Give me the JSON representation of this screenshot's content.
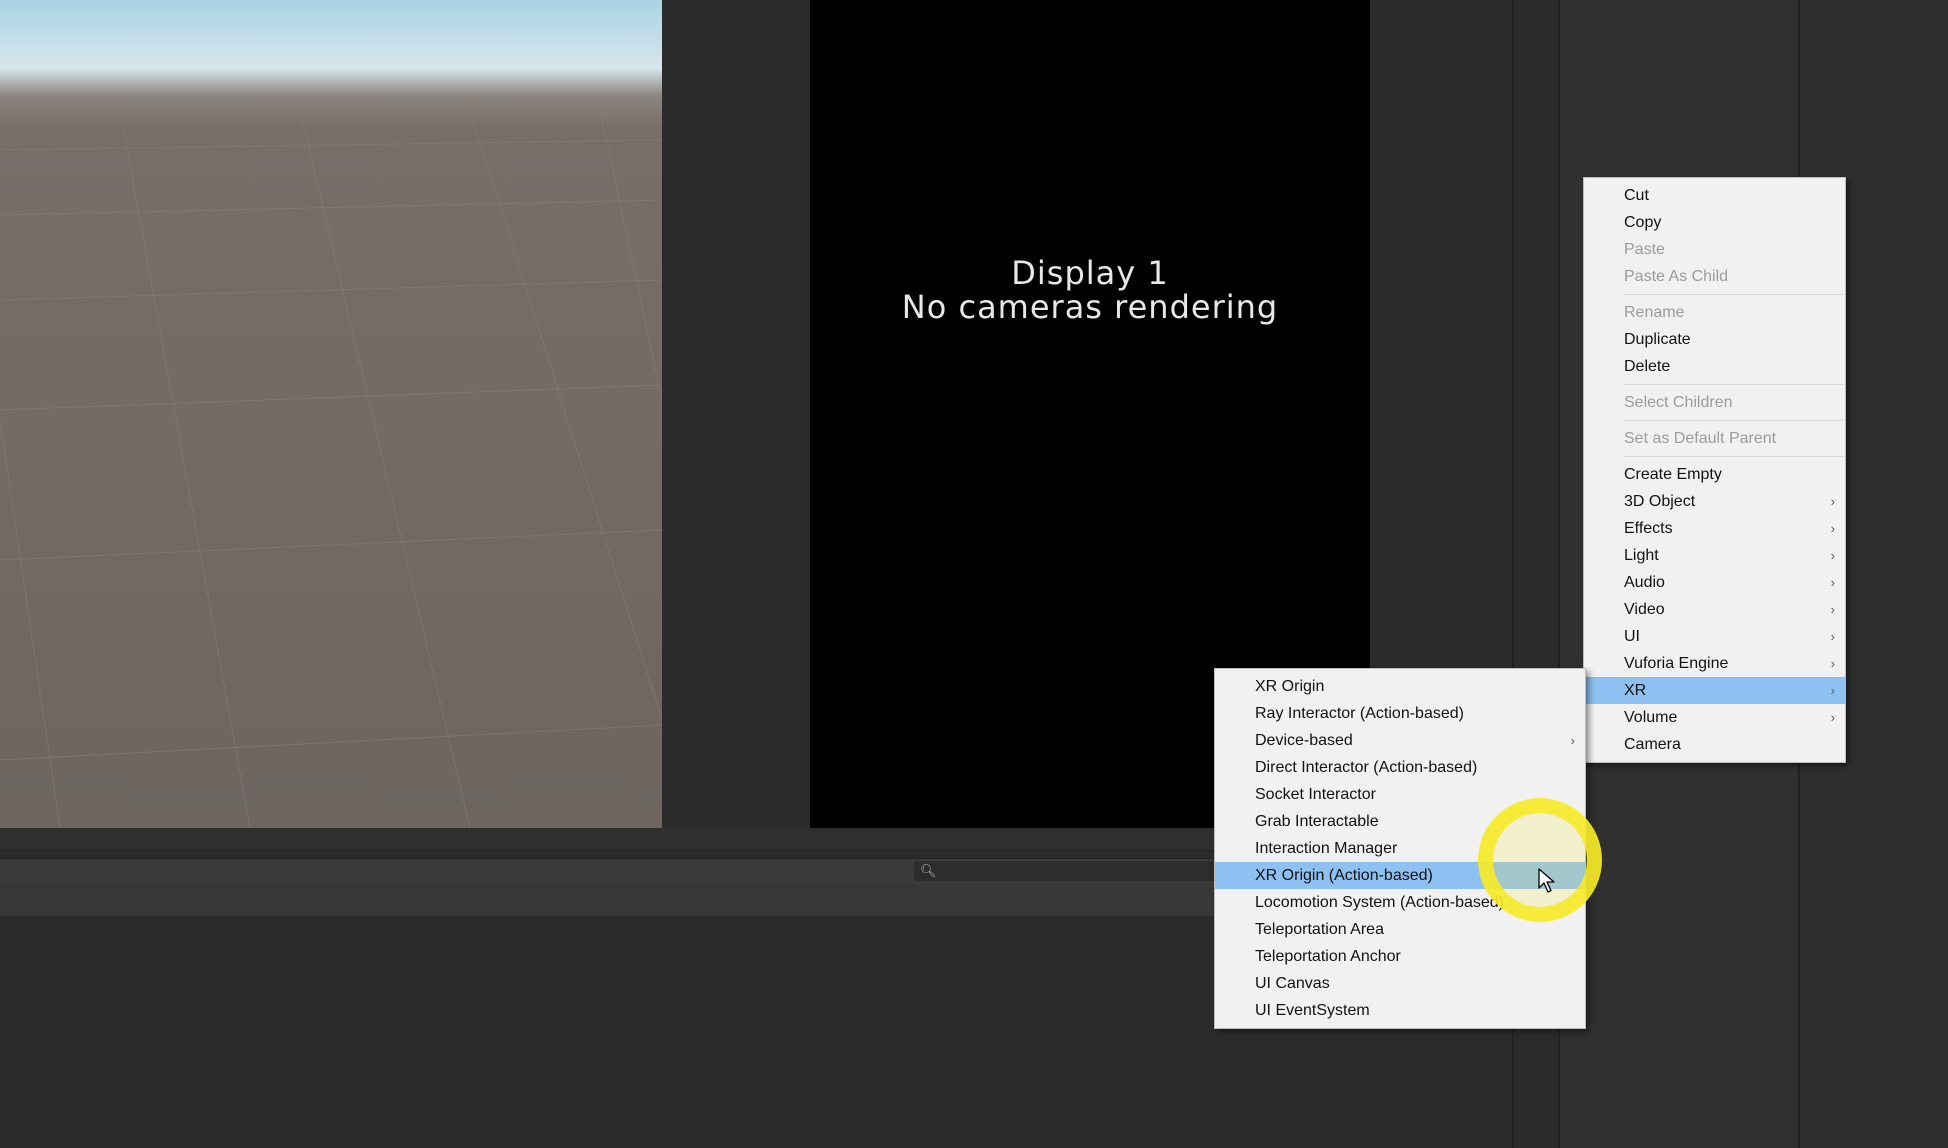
{
  "game_view": {
    "display_label": "Display 1",
    "message": "No cameras rendering"
  },
  "context_menu": {
    "items": [
      {
        "label": "Cut",
        "enabled": true
      },
      {
        "label": "Copy",
        "enabled": true
      },
      {
        "label": "Paste",
        "enabled": false
      },
      {
        "label": "Paste As Child",
        "enabled": false
      },
      {
        "label": "Rename",
        "enabled": false
      },
      {
        "label": "Duplicate",
        "enabled": true
      },
      {
        "label": "Delete",
        "enabled": true
      },
      {
        "label": "Select Children",
        "enabled": false
      },
      {
        "label": "Set as Default Parent",
        "enabled": false
      },
      {
        "label": "Create Empty",
        "enabled": true
      },
      {
        "label": "3D Object",
        "enabled": true,
        "submenu": true
      },
      {
        "label": "Effects",
        "enabled": true,
        "submenu": true
      },
      {
        "label": "Light",
        "enabled": true,
        "submenu": true
      },
      {
        "label": "Audio",
        "enabled": true,
        "submenu": true
      },
      {
        "label": "Video",
        "enabled": true,
        "submenu": true
      },
      {
        "label": "UI",
        "enabled": true,
        "submenu": true
      },
      {
        "label": "Vuforia Engine",
        "enabled": true,
        "submenu": true
      },
      {
        "label": "XR",
        "enabled": true,
        "submenu": true,
        "highlighted": true
      },
      {
        "label": "Volume",
        "enabled": true,
        "submenu": true
      },
      {
        "label": "Camera",
        "enabled": true
      }
    ]
  },
  "xr_submenu": {
    "items": [
      {
        "label": "XR Origin"
      },
      {
        "label": "Ray Interactor (Action-based)"
      },
      {
        "label": "Device-based",
        "submenu": true
      },
      {
        "label": "Direct Interactor (Action-based)"
      },
      {
        "label": "Socket Interactor"
      },
      {
        "label": "Grab Interactable"
      },
      {
        "label": "Interaction Manager"
      },
      {
        "label": "XR Origin (Action-based)",
        "highlighted": true
      },
      {
        "label": "Locomotion System (Action-based)"
      },
      {
        "label": "Teleportation Area"
      },
      {
        "label": "Teleportation Anchor"
      },
      {
        "label": "UI Canvas"
      },
      {
        "label": "UI EventSystem"
      }
    ]
  },
  "colors": {
    "highlight": "#8fc0f2",
    "cursor_ring": "#f6ea28",
    "menu_bg": "#f1f1f1"
  },
  "icons": {
    "submenu_arrow": "chevron-right-icon",
    "search": "search-icon",
    "cursor": "mouse-pointer-icon"
  }
}
